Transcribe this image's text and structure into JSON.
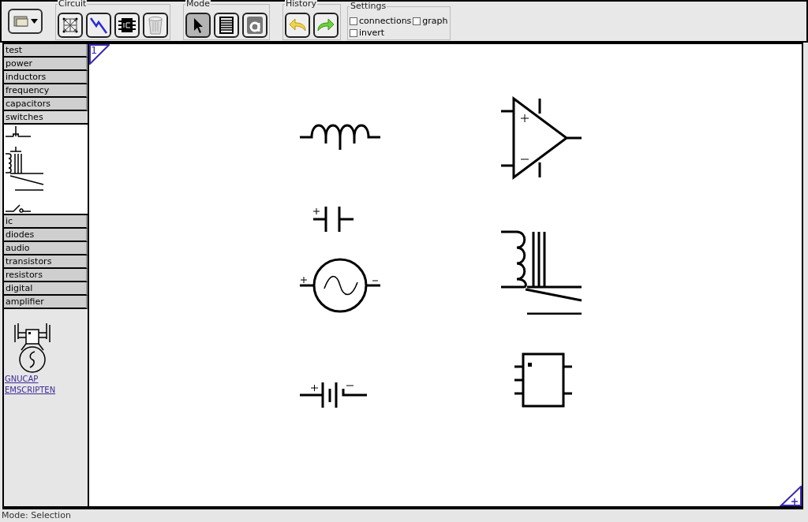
{
  "toolbar": {
    "groups": [
      {
        "label": "Circuit",
        "buttons": [
          {
            "kind": "net"
          },
          {
            "kind": "zap"
          },
          {
            "kind": "chip"
          },
          {
            "kind": "trash"
          }
        ]
      },
      {
        "label": "Mode",
        "buttons": [
          {
            "kind": "pointer",
            "selected": true
          },
          {
            "kind": "wire",
            "selected": false
          },
          {
            "kind": "text",
            "selected": false
          }
        ]
      },
      {
        "label": "History",
        "buttons": [
          {
            "kind": "undo"
          },
          {
            "kind": "redo"
          }
        ]
      }
    ],
    "settings": {
      "label": "Settings",
      "options": [
        {
          "label": "connections",
          "checked": false
        },
        {
          "label": "graph",
          "checked": false
        },
        {
          "label": "invert",
          "checked": false
        }
      ]
    }
  },
  "sidebar": {
    "categories": [
      {
        "label": "test",
        "expanded": false
      },
      {
        "label": "power",
        "expanded": false
      },
      {
        "label": "inductors",
        "expanded": false
      },
      {
        "label": "frequency",
        "expanded": false
      },
      {
        "label": "capacitors",
        "expanded": false
      },
      {
        "label": "switches",
        "expanded": true
      },
      {
        "label": "ic",
        "expanded": false
      },
      {
        "label": "diodes",
        "expanded": false
      },
      {
        "label": "audio",
        "expanded": false
      },
      {
        "label": "transistors",
        "expanded": false
      },
      {
        "label": "resistors",
        "expanded": false
      },
      {
        "label": "digital",
        "expanded": false
      },
      {
        "label": "amplifier",
        "expanded": false
      }
    ],
    "links": [
      "GNUCAP",
      "EMSCRIPTEN"
    ]
  },
  "canvas": {
    "page": "1",
    "components": [
      {
        "kind": "inductor"
      },
      {
        "kind": "opamp"
      },
      {
        "kind": "capacitor"
      },
      {
        "kind": "ac_source"
      },
      {
        "kind": "relay"
      },
      {
        "kind": "battery"
      },
      {
        "kind": "ic"
      }
    ]
  },
  "status_bar": "Mode: Selection"
}
